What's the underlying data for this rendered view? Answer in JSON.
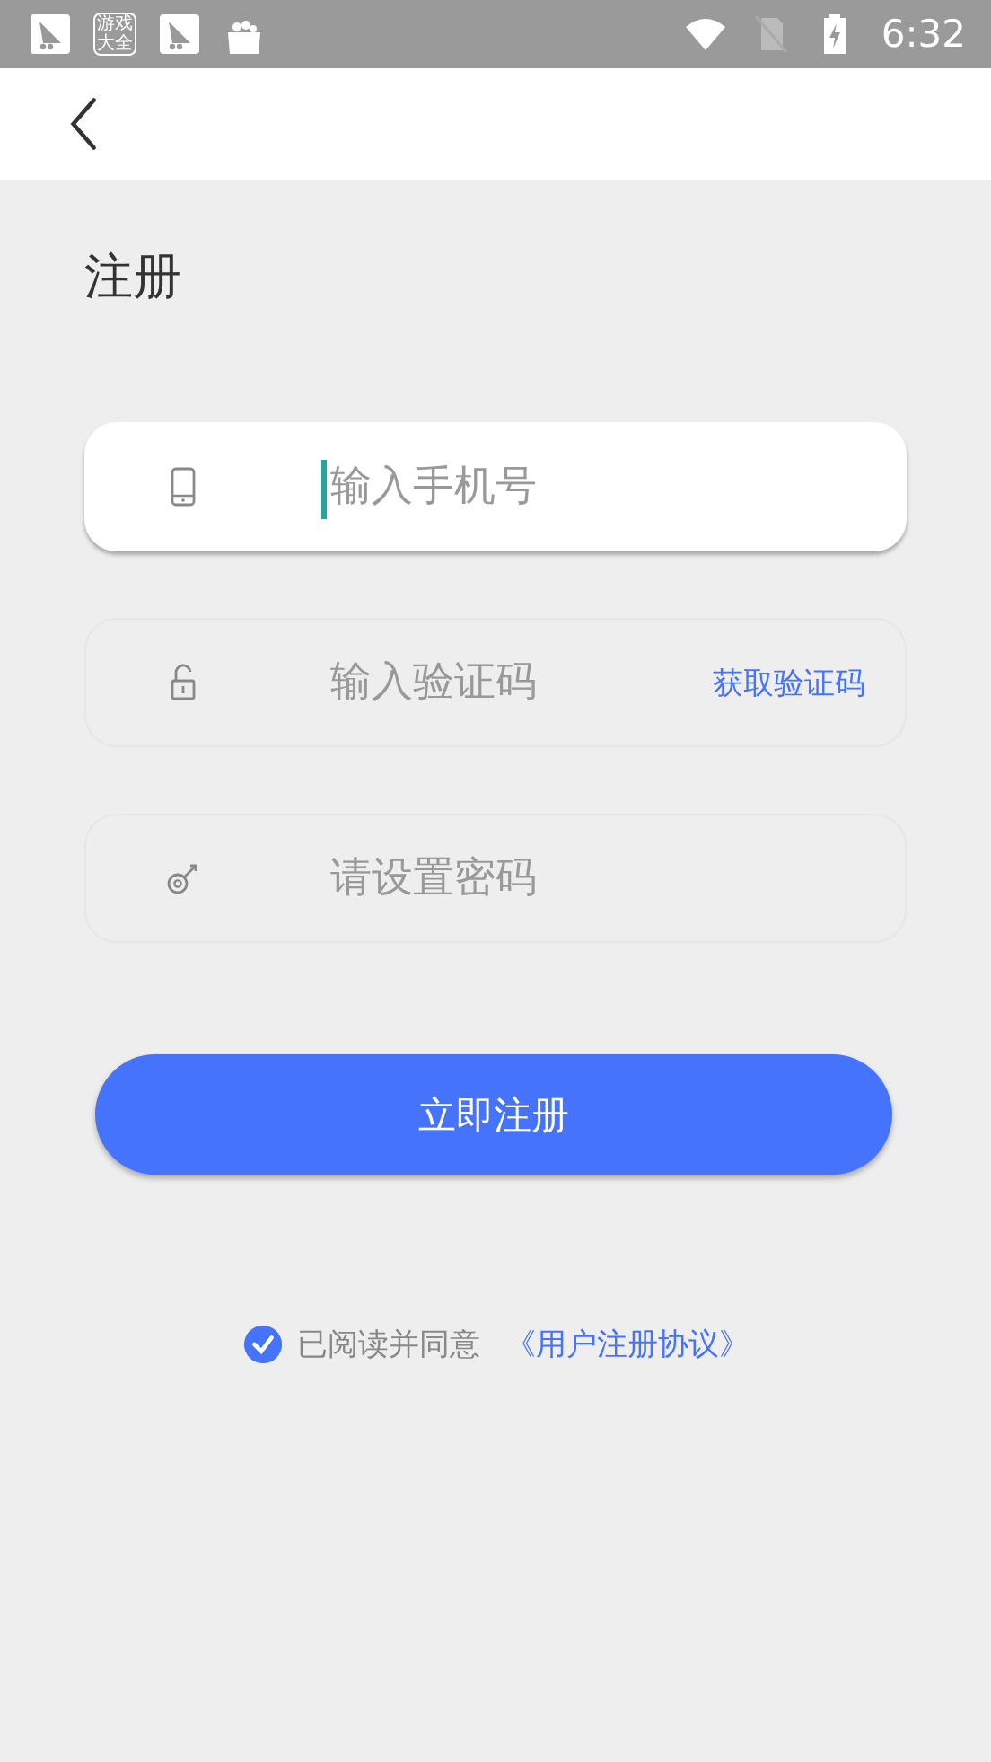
{
  "status_bar": {
    "time": "6:32",
    "app_icons": [
      {
        "kind": "leaf"
      },
      {
        "kind": "text",
        "label": "游戏大全"
      },
      {
        "kind": "leaf"
      },
      {
        "kind": "bag"
      }
    ]
  },
  "title": "注册",
  "fields": [
    {
      "kind": "phone",
      "placeholder": "输入手机号",
      "focused": true
    },
    {
      "kind": "lock",
      "placeholder": "输入验证码",
      "focused": false,
      "action": "获取验证码"
    },
    {
      "kind": "key",
      "placeholder": "请设置密码",
      "focused": false
    }
  ],
  "submit": "立即注册",
  "agreement": {
    "checked": true,
    "text": "已阅读并同意",
    "link": "《用户注册协议》"
  }
}
